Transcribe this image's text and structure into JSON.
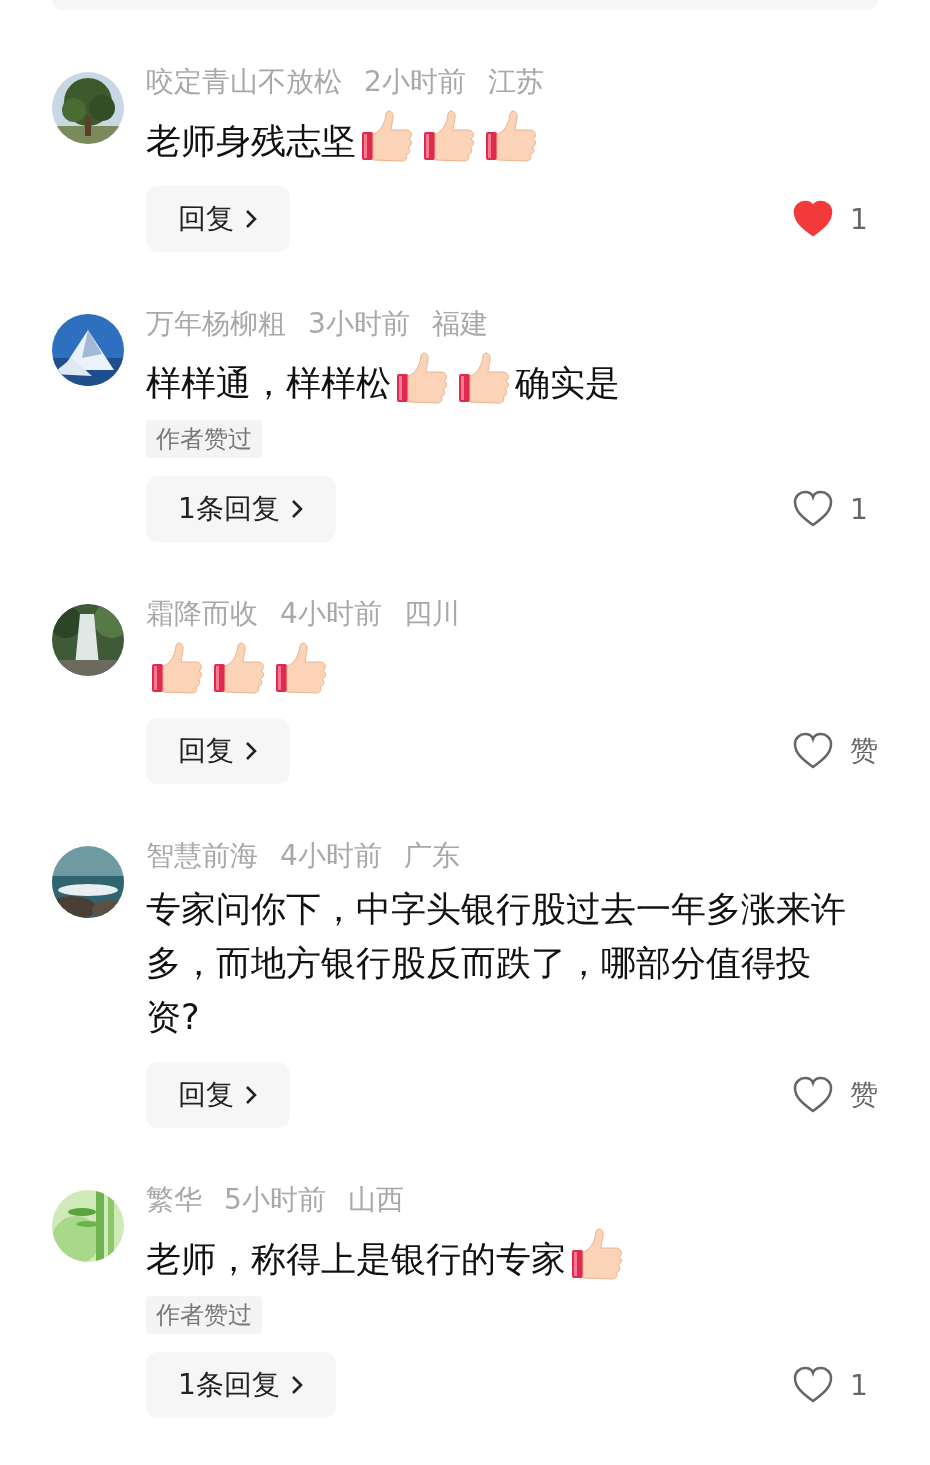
{
  "comments": [
    {
      "user": "咬定青山不放松",
      "time": "2小时前",
      "location": "江苏",
      "content": [
        {
          "kind": "text",
          "text": "老师身残志坚"
        },
        {
          "kind": "thumbs_up"
        },
        {
          "kind": "thumbs_up"
        },
        {
          "kind": "thumbs_up"
        }
      ],
      "author_liked": false,
      "reply_label": "回复",
      "liked": true,
      "like_label": "1"
    },
    {
      "user": "万年杨柳粗",
      "time": "3小时前",
      "location": "福建",
      "content": [
        {
          "kind": "text",
          "text": "样样通，样样松"
        },
        {
          "kind": "thumbs_up"
        },
        {
          "kind": "thumbs_up"
        },
        {
          "kind": "text",
          "text": "确实是"
        }
      ],
      "author_liked": true,
      "author_badge": "作者赞过",
      "reply_label": "1条回复",
      "liked": false,
      "like_label": "1"
    },
    {
      "user": "霜降而收",
      "time": "4小时前",
      "location": "四川",
      "content": [
        {
          "kind": "thumbs_up"
        },
        {
          "kind": "thumbs_up"
        },
        {
          "kind": "thumbs_up"
        }
      ],
      "author_liked": false,
      "reply_label": "回复",
      "liked": false,
      "like_label": "赞"
    },
    {
      "user": "智慧前海",
      "time": "4小时前",
      "location": "广东",
      "content": [
        {
          "kind": "text",
          "text": "专家问你下，中字头银行股过去一年多涨来许多，而地方银行股反而跌了，哪部分值得投资?"
        }
      ],
      "author_liked": false,
      "reply_label": "回复",
      "liked": false,
      "like_label": "赞"
    },
    {
      "user": "繁华",
      "time": "5小时前",
      "location": "山西",
      "content": [
        {
          "kind": "text",
          "text": "老师，称得上是银行的专家"
        },
        {
          "kind": "thumbs_up"
        }
      ],
      "author_liked": true,
      "author_badge": "作者赞过",
      "reply_label": "1条回复",
      "liked": false,
      "like_label": "1"
    }
  ]
}
